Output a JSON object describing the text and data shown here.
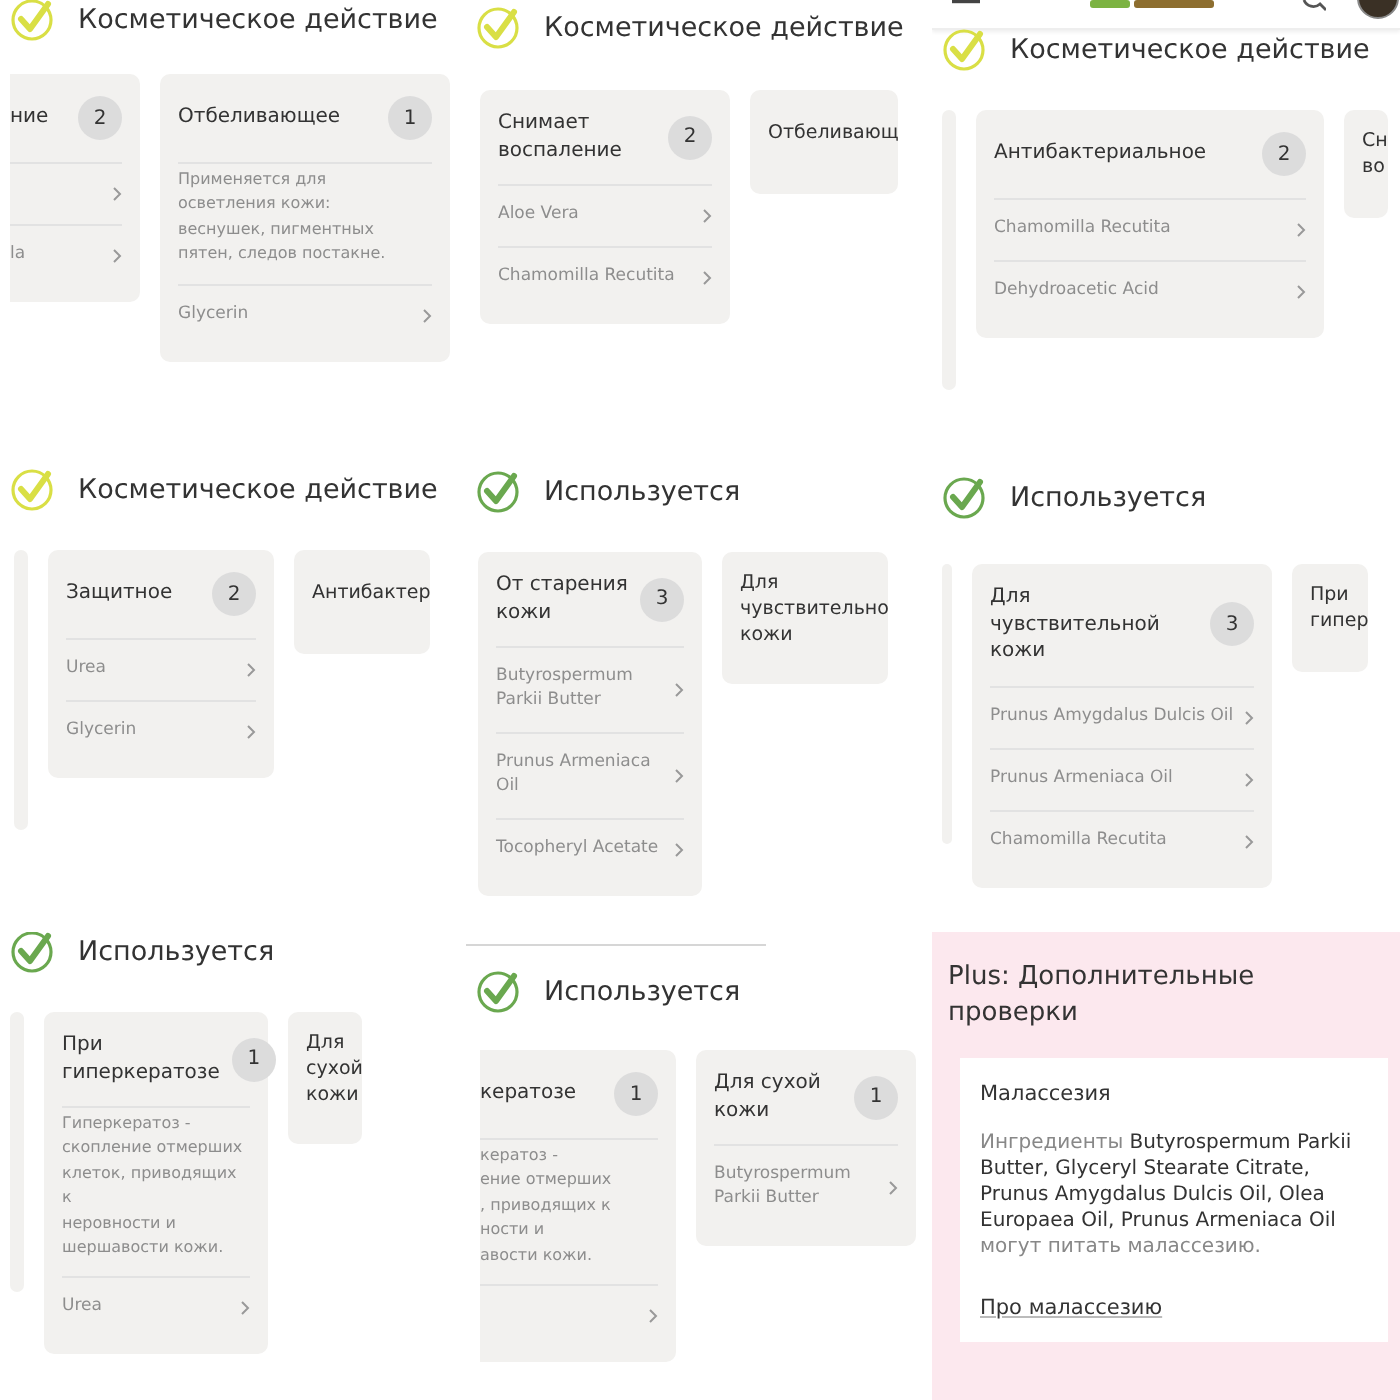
{
  "panels": [
    {
      "kind": "section",
      "heading": "Косметическое действие",
      "color": "#d9df45",
      "cards": [
        {
          "kind": "card",
          "title": "ние",
          "count": "2",
          "items": [
            {
              "kind": "blank"
            },
            {
              "kind": "named",
              "name": "la"
            }
          ]
        },
        {
          "kind": "card",
          "title": "Отбеливающее",
          "count": "1",
          "description": [
            "Применяется для",
            "осветления кожи:",
            "веснушек, пигментных",
            "пятен, следов постакне."
          ],
          "items": [
            {
              "kind": "named",
              "name": "Glycerin"
            }
          ]
        }
      ]
    },
    {
      "kind": "section",
      "heading": "Косметическое действие",
      "color": "#d9df45",
      "cards": [
        {
          "kind": "card",
          "title": "Снимает воспаление",
          "count": "2",
          "items": [
            {
              "kind": "named",
              "name": "Aloe Vera"
            },
            {
              "kind": "named",
              "name": "Chamomilla Recutita"
            }
          ]
        },
        {
          "kind": "card",
          "title": "Отбеливающ"
        }
      ]
    },
    {
      "kind": "section",
      "top_bar": true,
      "heading": "Косметическое действие",
      "color": "#d9df45",
      "cards": [
        {
          "kind": "edge"
        },
        {
          "kind": "card",
          "title": "Антибактериальное",
          "count": "2",
          "items": [
            {
              "kind": "named",
              "name": "Chamomilla Recutita"
            },
            {
              "kind": "named",
              "name": "Dehydroacetic Acid"
            }
          ]
        },
        {
          "kind": "card",
          "title": "Сн во"
        }
      ]
    },
    {
      "kind": "section",
      "heading": "Косметическое действие",
      "color": "#d9df45",
      "cards": [
        {
          "kind": "edge"
        },
        {
          "kind": "card",
          "title": "Защитное",
          "count": "2",
          "items": [
            {
              "kind": "named",
              "name": "Urea"
            },
            {
              "kind": "named",
              "name": "Glycerin"
            }
          ]
        },
        {
          "kind": "card",
          "title": "Антибактер"
        }
      ]
    },
    {
      "kind": "section",
      "heading": "Используется",
      "color": "#6aa84f",
      "cards": [
        {
          "kind": "card",
          "title": "От старения кожи",
          "count": "3",
          "items": [
            {
              "kind": "named",
              "name": "Butyrospermum Parkii Butter"
            },
            {
              "kind": "named",
              "name": "Prunus Armeniaca Oil"
            },
            {
              "kind": "named",
              "name": "Tocopheryl Acetate"
            }
          ]
        },
        {
          "kind": "card",
          "title": "Для чувствительно кожи"
        }
      ]
    },
    {
      "kind": "section",
      "heading": "Используется",
      "color": "#6aa84f",
      "cards": [
        {
          "kind": "edge"
        },
        {
          "kind": "card",
          "title": "Для чувствительной кожи",
          "count": "3",
          "items": [
            {
              "kind": "named",
              "name": "Prunus Amygdalus Dulcis Oil"
            },
            {
              "kind": "named",
              "name": "Prunus Armeniaca Oil"
            },
            {
              "kind": "named",
              "name": "Chamomilla Recutita"
            }
          ]
        },
        {
          "kind": "card",
          "title": "При гипер"
        }
      ]
    },
    {
      "kind": "section",
      "heading": "Используется",
      "color": "#6aa84f",
      "cards": [
        {
          "kind": "edge"
        },
        {
          "kind": "card",
          "title": "При гиперкератозе",
          "count": "1",
          "description": [
            "Гиперкератоз -",
            "скопление отмерших",
            "клеток, приводящих к",
            "неровности и",
            "шершавости кожи."
          ],
          "items": [
            {
              "kind": "named",
              "name": "Urea"
            }
          ]
        },
        {
          "kind": "card",
          "title": "Для сухой кожи"
        }
      ]
    },
    {
      "kind": "section",
      "top_line": true,
      "heading": "Используется",
      "color": "#6aa84f",
      "cards": [
        {
          "kind": "card",
          "title": "кератозе",
          "count": "1",
          "description": [
            "кератоз -",
            "ение отмерших",
            ", приводящих к",
            "ности и",
            "авости кожи."
          ],
          "items": [
            {
              "kind": "blank"
            }
          ]
        },
        {
          "kind": "card",
          "title": "Для сухой кожи",
          "count": "1",
          "items": [
            {
              "kind": "named",
              "name": "Butyrospermum Parkii Butter"
            }
          ]
        }
      ]
    },
    {
      "kind": "plus",
      "title": "Plus: Дополнительные проверки",
      "card": {
        "heading": "Малассезия",
        "text": "Ингредиенты **Butyrospermum Parkii Butter, Glyceryl Stearate Citrate, Prunus Amygdalus Dulcis Oil, Olea Europaea Oil, Prunus Armeniaca Oil** могут питать малассезию.",
        "link": "Про малассезию"
      }
    }
  ]
}
